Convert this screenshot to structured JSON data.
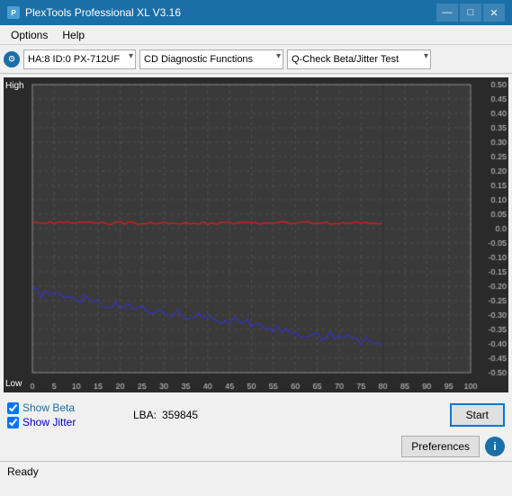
{
  "titleBar": {
    "title": "PlexTools Professional XL V3.16",
    "minimizeLabel": "—",
    "maximizeLabel": "□",
    "closeLabel": "✕"
  },
  "menuBar": {
    "options": "Options",
    "help": "Help"
  },
  "toolbar": {
    "deviceLabel": "HA:8 ID:0  PX-712UF",
    "functionLabel": "CD Diagnostic Functions",
    "testLabel": "Q-Check Beta/Jitter Test"
  },
  "chart": {
    "yAxisHigh": "High",
    "yAxisLow": "Low",
    "yAxisRight": [
      "0.5",
      "0.45",
      "0.4",
      "0.35",
      "0.3",
      "0.25",
      "0.2",
      "0.15",
      "0.1",
      "0.05",
      "0",
      "-0.05",
      "-0.1",
      "-0.15",
      "-0.2",
      "-0.25",
      "-0.3",
      "-0.35",
      "-0.4",
      "-0.45",
      "-0.5"
    ],
    "xAxisLabels": [
      "0",
      "5",
      "10",
      "15",
      "20",
      "25",
      "30",
      "35",
      "40",
      "45",
      "50",
      "55",
      "60",
      "65",
      "70",
      "75",
      "80",
      "85",
      "90",
      "95",
      "100"
    ]
  },
  "bottomPanel": {
    "showBetaLabel": "Show Beta",
    "showJitterLabel": "Show Jitter",
    "lbaLabel": "LBA:",
    "lbaValue": "359845",
    "startButton": "Start",
    "preferencesButton": "Preferences",
    "infoButton": "i"
  },
  "statusBar": {
    "status": "Ready"
  }
}
